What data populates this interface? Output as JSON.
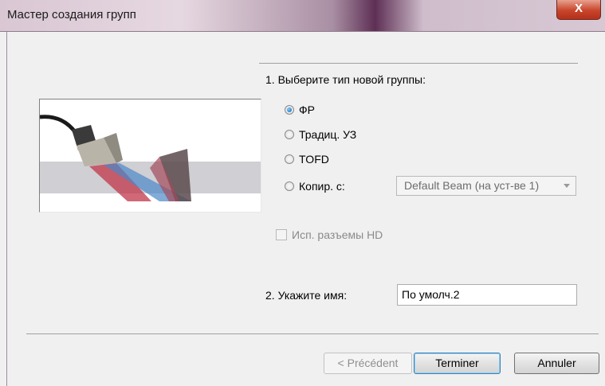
{
  "window": {
    "title": "Мастер создания групп",
    "close_glyph": "X"
  },
  "step1": {
    "label": "1. Выберите тип новой группы:"
  },
  "group_types": [
    {
      "label": "ФР",
      "selected": true
    },
    {
      "label": "Традиц. УЗ",
      "selected": false
    },
    {
      "label": "TOFD",
      "selected": false
    },
    {
      "label": "Копир. с:",
      "selected": false
    }
  ],
  "copy_source": {
    "value": "Default Beam (на уст-ве 1)"
  },
  "hd_connectors": {
    "label": "Исп. разъемы HD",
    "checked": false,
    "enabled": false
  },
  "step2": {
    "label": "2. Укажите имя:",
    "value": "По умолч.2"
  },
  "buttons": {
    "back": "< Précédent",
    "finish": "Terminer",
    "cancel": "Annuler"
  },
  "colors": {
    "accent": "#0a5fb4",
    "close_red": "#c8442a"
  },
  "icons": {
    "close": "close-icon",
    "illustration": "phased-array-probe-illustration"
  }
}
